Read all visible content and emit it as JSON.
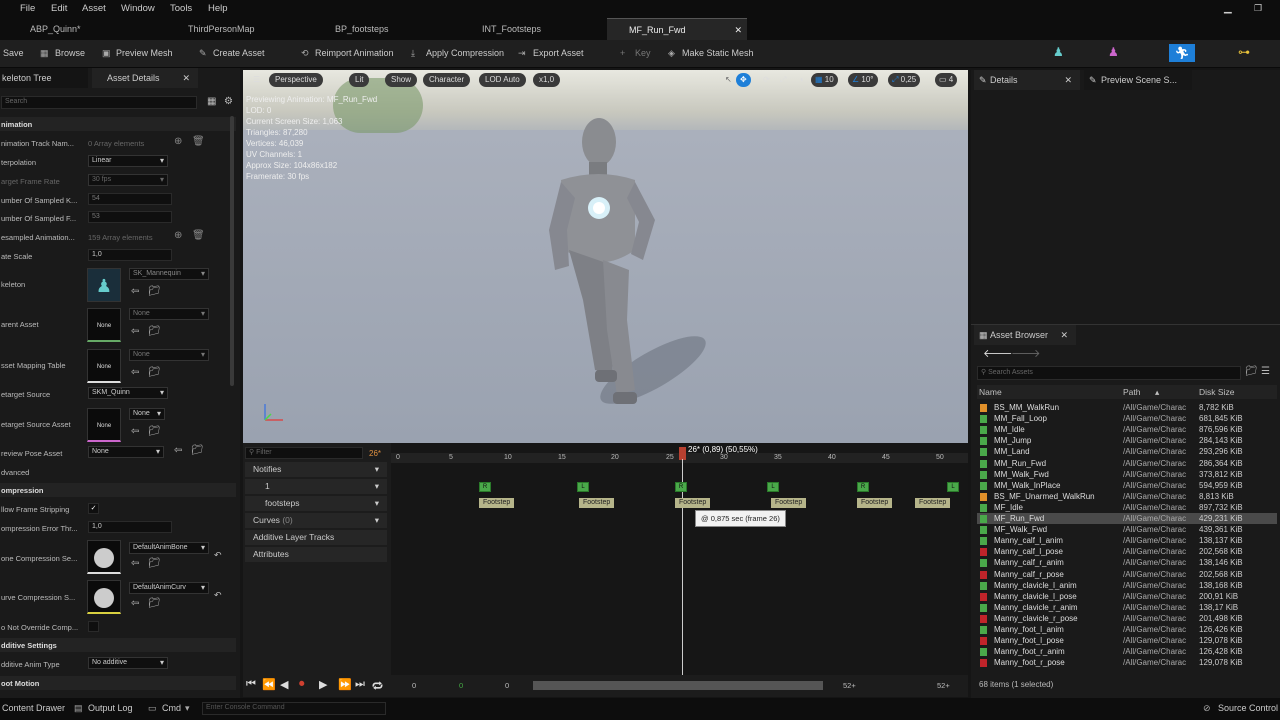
{
  "menu": [
    "File",
    "Edit",
    "Asset",
    "Window",
    "Tools",
    "Help"
  ],
  "tabs": [
    "ABP_Quinn*",
    "ThirdPersonMap",
    "BP_footsteps",
    "INT_Footsteps",
    "MF_Run_Fwd"
  ],
  "toolbar": {
    "save": "Save",
    "browse": "Browse",
    "preview_mesh": "Preview Mesh",
    "create_asset": "Create Asset",
    "reimport": "Reimport Animation",
    "apply_compression": "Apply Compression",
    "export_asset": "Export Asset",
    "key": "Key",
    "make_static_mesh": "Make Static Mesh"
  },
  "left_panel": {
    "tab1": "keleton Tree",
    "tab2": "Asset Details",
    "search_placeholder": "Search",
    "sections": [
      "nimation",
      "ompression",
      "dditive Settings",
      "oot Motion"
    ],
    "rows": [
      {
        "label": "nimation Track Nam...",
        "value": "0 Array elements"
      },
      {
        "label": "terpolation",
        "value": "Linear"
      },
      {
        "label": "arget Frame Rate",
        "value": "30 fps"
      },
      {
        "label": "umber Of Sampled K...",
        "value": "54"
      },
      {
        "label": "umber Of Sampled F...",
        "value": "53"
      },
      {
        "label": "esampled Animation...",
        "value": "159 Array elements"
      },
      {
        "label": "ate Scale",
        "value": "1,0"
      },
      {
        "label": "keleton",
        "value": "SK_Mannequin"
      },
      {
        "label": "arent Asset",
        "value": "None"
      },
      {
        "label": "sset Mapping Table",
        "value": "None"
      },
      {
        "label": "etarget Source",
        "value": "SKM_Quinn"
      },
      {
        "label": "etarget Source Asset",
        "value": "None"
      },
      {
        "label": "review Pose Asset",
        "value": "None"
      },
      {
        "label": "dvanced",
        "value": ""
      },
      {
        "label": "llow Frame Stripping",
        "value": ""
      },
      {
        "label": "ompression Error Thr...",
        "value": "1,0"
      },
      {
        "label": "one Compression Se...",
        "value": "DefaultAnimBone"
      },
      {
        "label": "urve Compression S...",
        "value": "DefaultAnimCurv"
      },
      {
        "label": "o Not Override Comp...",
        "value": ""
      },
      {
        "label": "dditive Anim Type",
        "value": "No additive"
      }
    ],
    "none_thumb": "None"
  },
  "viewport": {
    "buttons": [
      "Perspective",
      "Lit",
      "Show",
      "Character",
      "LOD Auto",
      "x1,0"
    ],
    "right_buttons": [
      "10",
      "10°",
      "0,25",
      "4"
    ],
    "info": [
      "Previewing Animation: MF_Run_Fwd",
      "LOD: 0",
      "Current Screen Size: 1,063",
      "Triangles: 87,280",
      "Vertices: 46,039",
      "UV Channels: 1",
      "Approx Size: 104x86x182",
      "Framerate: 30 fps"
    ]
  },
  "timeline": {
    "filter_placeholder": "Filter",
    "frame": "26*",
    "playhead": "26* (0,89) (50,55%)",
    "rows": [
      "Notifies",
      "1",
      "footsteps",
      "Curves",
      "Additive Layer Tracks",
      "Attributes"
    ],
    "curves_count": "(0)",
    "ticks": [
      "0",
      "5",
      "10",
      "15",
      "20",
      "25",
      "30",
      "35",
      "40",
      "45",
      "50"
    ],
    "notify_label": "Footstep",
    "tooltip": "@ 0,875 sec (frame 26)",
    "bottom": [
      "0",
      "0",
      "0",
      "52+",
      "52+"
    ]
  },
  "right_panel": {
    "details_tab": "Details",
    "preview_tab": "Preview Scene S...",
    "asset_browser_tab": "Asset Browser",
    "search_placeholder": "Search Assets",
    "cols": [
      "Name",
      "Path",
      "Disk Size"
    ],
    "assets": [
      {
        "name": "BS_MM_WalkRun",
        "path": "/All/Game/Charac",
        "size": "8,782 KiB",
        "color": "#e0902a"
      },
      {
        "name": "MM_Fall_Loop",
        "path": "/All/Game/Charac",
        "size": "681,845 KiB",
        "color": "#4aa84a"
      },
      {
        "name": "MM_Idle",
        "path": "/All/Game/Charac",
        "size": "876,596 KiB",
        "color": "#4aa84a"
      },
      {
        "name": "MM_Jump",
        "path": "/All/Game/Charac",
        "size": "284,143 KiB",
        "color": "#4aa84a"
      },
      {
        "name": "MM_Land",
        "path": "/All/Game/Charac",
        "size": "293,296 KiB",
        "color": "#4aa84a"
      },
      {
        "name": "MM_Run_Fwd",
        "path": "/All/Game/Charac",
        "size": "286,364 KiB",
        "color": "#4aa84a"
      },
      {
        "name": "MM_Walk_Fwd",
        "path": "/All/Game/Charac",
        "size": "373,812 KiB",
        "color": "#4aa84a"
      },
      {
        "name": "MM_Walk_InPlace",
        "path": "/All/Game/Charac",
        "size": "594,959 KiB",
        "color": "#4aa84a"
      },
      {
        "name": "BS_MF_Unarmed_WalkRun",
        "path": "/All/Game/Charac",
        "size": "8,813 KiB",
        "color": "#e0902a"
      },
      {
        "name": "MF_Idle",
        "path": "/All/Game/Charac",
        "size": "897,732 KiB",
        "color": "#4aa84a"
      },
      {
        "name": "MF_Run_Fwd",
        "path": "/All/Game/Charac",
        "size": "429,231 KiB",
        "color": "#4aa84a"
      },
      {
        "name": "MF_Walk_Fwd",
        "path": "/All/Game/Charac",
        "size": "439,361 KiB",
        "color": "#4aa84a"
      },
      {
        "name": "Manny_calf_l_anim",
        "path": "/All/Game/Charac",
        "size": "138,137 KiB",
        "color": "#4aa84a"
      },
      {
        "name": "Manny_calf_l_pose",
        "path": "/All/Game/Charac",
        "size": "202,568 KiB",
        "color": "#c0242a"
      },
      {
        "name": "Manny_calf_r_anim",
        "path": "/All/Game/Charac",
        "size": "138,146 KiB",
        "color": "#4aa84a"
      },
      {
        "name": "Manny_calf_r_pose",
        "path": "/All/Game/Charac",
        "size": "202,568 KiB",
        "color": "#c0242a"
      },
      {
        "name": "Manny_clavicle_l_anim",
        "path": "/All/Game/Charac",
        "size": "138,168 KiB",
        "color": "#4aa84a"
      },
      {
        "name": "Manny_clavicle_l_pose",
        "path": "/All/Game/Charac",
        "size": "200,91 KiB",
        "color": "#c0242a"
      },
      {
        "name": "Manny_clavicle_r_anim",
        "path": "/All/Game/Charac",
        "size": "138,17 KiB",
        "color": "#4aa84a"
      },
      {
        "name": "Manny_clavicle_r_pose",
        "path": "/All/Game/Charac",
        "size": "201,498 KiB",
        "color": "#c0242a"
      },
      {
        "name": "Manny_foot_l_anim",
        "path": "/All/Game/Charac",
        "size": "126,426 KiB",
        "color": "#4aa84a"
      },
      {
        "name": "Manny_foot_l_pose",
        "path": "/All/Game/Charac",
        "size": "129,078 KiB",
        "color": "#c0242a"
      },
      {
        "name": "Manny_foot_r_anim",
        "path": "/All/Game/Charac",
        "size": "126,428 KiB",
        "color": "#4aa84a"
      },
      {
        "name": "Manny_foot_r_pose",
        "path": "/All/Game/Charac",
        "size": "129,078 KiB",
        "color": "#c0242a"
      }
    ],
    "count": "68 items (1 selected)"
  },
  "status": {
    "content_drawer": "Content Drawer",
    "output_log": "Output Log",
    "cmd": "Cmd",
    "console_placeholder": "Enter Console Command",
    "source_control": "Source Control"
  }
}
